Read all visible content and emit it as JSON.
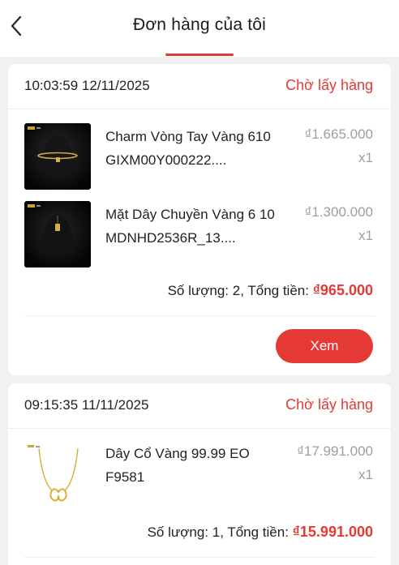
{
  "header": {
    "title": "Đơn hàng của tôi",
    "back_icon": "chevron-left-icon"
  },
  "colors": {
    "accent": "#e53935",
    "muted_text": "#9e9e9e",
    "background": "#f1f1f1"
  },
  "orders": [
    {
      "time": "10:03:59 12/11/2025",
      "status": "Chờ lấy hàng",
      "items": [
        {
          "name": "Charm Vòng Tay Vàng 610 GIXM00Y000222....",
          "price": "₫1.665.000",
          "qty": "x1",
          "thumb_icon": "gold-bracelet-charm-image"
        },
        {
          "name": "Mặt Dây Chuyền Vàng 6 10 MDNHD2536R_13....",
          "price": "₫1.300.000",
          "qty": "x1",
          "thumb_icon": "gold-pendant-image"
        }
      ],
      "summary_prefix": "Số lượng: 2, Tổng tiền: ",
      "total": "₫965.000",
      "action_label": "Xem"
    },
    {
      "time": "09:15:35 11/11/2025",
      "status": "Chờ lấy hàng",
      "items": [
        {
          "name": "Dây Cổ Vàng 99.99 EO F9581",
          "price": "₫17.991.000",
          "qty": "x1",
          "thumb_icon": "gold-necklace-image"
        }
      ],
      "summary_prefix": "Số lượng: 1, Tổng tiền: ",
      "total": "₫15.991.000"
    }
  ]
}
